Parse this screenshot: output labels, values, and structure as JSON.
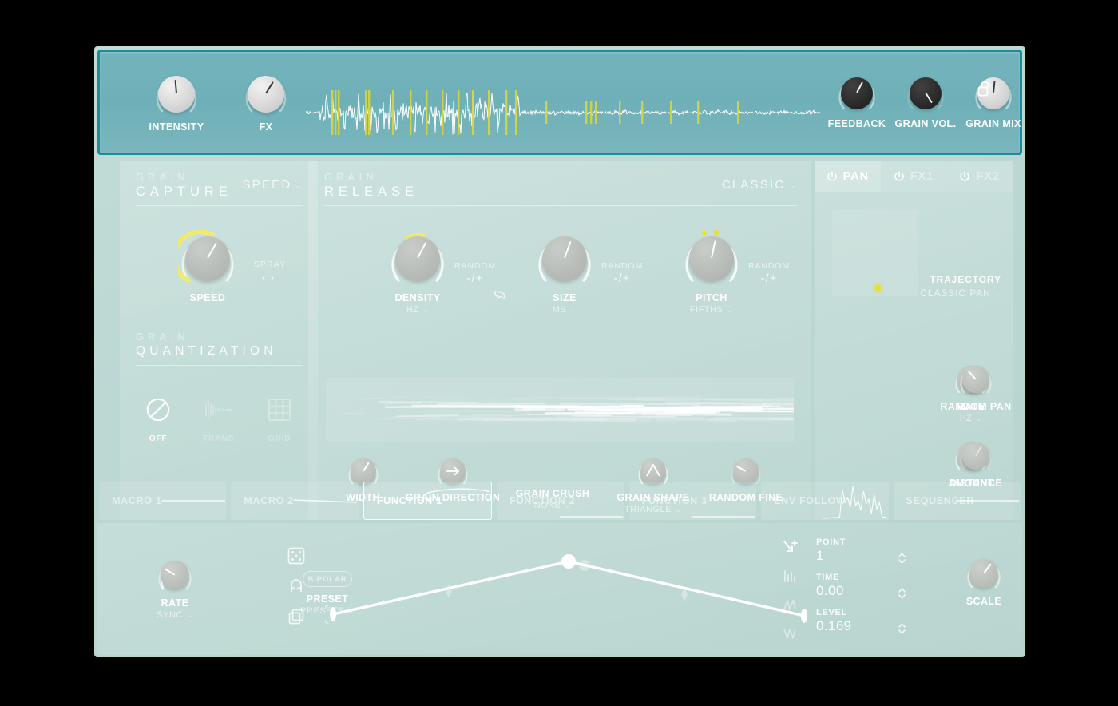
{
  "header": {
    "knobs": [
      {
        "label": "INTENSITY",
        "style": "light",
        "angle": -5,
        "arc": 0.52
      },
      {
        "label": "FX",
        "style": "light",
        "angle": 32,
        "arc": 0.62
      },
      {
        "label": "FEEDBACK",
        "style": "dark",
        "angle": 28,
        "arc": 0.6
      },
      {
        "label": "GRAIN VOL.",
        "style": "dark",
        "angle": 148,
        "arc": 0.97
      },
      {
        "label": "GRAIN MIX",
        "style": "light",
        "angle": 6,
        "arc": 0.56
      }
    ],
    "lock_icon": "unlocked-padlock-icon",
    "waveform_name": "sample-waveform-display",
    "waveform_colors": {
      "wave": "#ffffff",
      "grain_marker": "#d8d63a"
    }
  },
  "grain_capture": {
    "section_top": "GRAIN",
    "section_main": "CAPTURE",
    "mode_select": "SPEED",
    "knob": {
      "label": "SPEED",
      "angle": 30,
      "arc": 0.62,
      "highlight_color": "#f0ea6e"
    },
    "spray": {
      "label": "SPRAY",
      "left_arrow": "‹",
      "right_arrow": "›"
    }
  },
  "grain_quantization": {
    "section_top": "GRAIN",
    "section_main": "QUANTIZATION",
    "options": [
      {
        "label": "OFF",
        "icon": "no-entry-icon",
        "selected": true
      },
      {
        "label": "TRANS.",
        "icon": "transient-waveform-icon",
        "selected": false
      },
      {
        "label": "GRID",
        "icon": "grid-icon",
        "selected": false
      }
    ]
  },
  "grain_release": {
    "section_top": "GRAIN",
    "section_main": "RELEASE",
    "mode_select": "CLASSIC",
    "main_knobs": [
      {
        "label": "DENSITY",
        "unit": "HZ",
        "random_label": "RANDOM",
        "random_value": "-/+",
        "angle": 28,
        "arc": 0.63,
        "highlight": true,
        "dots": 0
      },
      {
        "label": "SIZE",
        "unit": "MS",
        "random_label": "RANDOM",
        "random_value": "-/+",
        "angle": 20,
        "arc": 0.6,
        "highlight": false,
        "dots": 0
      },
      {
        "label": "PITCH",
        "unit": "FIFTHS",
        "random_label": "RANDOM",
        "random_value": "-/+",
        "angle": 12,
        "arc": 0.55,
        "highlight": false,
        "dots": 2
      }
    ],
    "link_icon": "chain-link-icon",
    "viz_name": "grain-stream-visualizer",
    "small_controls": [
      {
        "label": "WIDTH",
        "sub": "",
        "type": "knob",
        "angle": 32,
        "arc": 0.62
      },
      {
        "label": "GRAIN DIRECTION",
        "sub": "",
        "type": "icon",
        "icon": "arrow-right-icon",
        "arc": 0.7
      },
      {
        "label": "GRAIN CRUSH",
        "sub": "NONE",
        "type": "none"
      },
      {
        "label": "GRAIN SHAPE",
        "sub": "TRIANGLE",
        "type": "icon",
        "icon": "triangle-shape-icon",
        "arc": 0.8
      },
      {
        "label": "RANDOM FINE",
        "sub": "",
        "type": "knob",
        "angle": -62,
        "arc": 0.2
      }
    ]
  },
  "right_panel": {
    "tabs": [
      {
        "label": "PAN",
        "active": true,
        "power_icon": "power-icon"
      },
      {
        "label": "FX1",
        "active": false,
        "power_icon": "power-icon"
      },
      {
        "label": "FX2",
        "active": false,
        "power_icon": "power-icon"
      }
    ],
    "xypad": {
      "name": "pan-xy-pad",
      "dot_x": 0.49,
      "dot_y": 0.86,
      "dot_color": "#e8e03a"
    },
    "trajectory": {
      "label": "TRAJECTORY",
      "value": "CLASSIC PAN"
    },
    "knobs": [
      {
        "label": "RATE",
        "sub": "HZ",
        "angle": -24,
        "arc": 0.4
      },
      {
        "label": "RANDOM PAN",
        "sub": "",
        "angle": -42,
        "arc": 0.3
      },
      {
        "label": "AMOUNT",
        "sub": "",
        "angle": 24,
        "arc": 0.58
      },
      {
        "label": "DISTANCE",
        "sub": "",
        "angle": 30,
        "arc": 0.0
      }
    ]
  },
  "mod_bar": {
    "tabs": [
      {
        "label": "MACRO 1",
        "active": false,
        "viz": "flat-line"
      },
      {
        "label": "MACRO 2",
        "active": false,
        "viz": "flat-line"
      },
      {
        "label": "FUNCTION 1",
        "active": true,
        "viz": "curve"
      },
      {
        "label": "FUNCTION 2",
        "active": false,
        "viz": "flat-line"
      },
      {
        "label": "FUNCTION 3",
        "active": false,
        "viz": "flat-line"
      },
      {
        "label": "ENV FOLLOW",
        "active": false,
        "viz": "envelope"
      },
      {
        "label": "SEQUENCER",
        "active": false,
        "viz": "flat-line"
      }
    ]
  },
  "function_editor": {
    "rate": {
      "label": "RATE",
      "sub": "SYNC",
      "angle": -58,
      "arc": 0.22
    },
    "bipolar_label": "BIPOLAR",
    "preset": {
      "label": "PRESET",
      "sub": "PRESETS"
    },
    "side_icons": [
      {
        "name": "dice-icon"
      },
      {
        "name": "magnet-icon"
      },
      {
        "name": "copy-icon"
      }
    ],
    "value_icons": [
      {
        "name": "add-point-icon",
        "active": true
      },
      {
        "name": "bar-steps-icon",
        "active": false
      },
      {
        "name": "ramp-up-icon",
        "active": false
      },
      {
        "name": "ramp-down-icon",
        "active": false
      }
    ],
    "values": [
      {
        "label": "POINT",
        "value": "1"
      },
      {
        "label": "TIME",
        "value": "0.00"
      },
      {
        "label": "LEVEL",
        "value": "0.169"
      }
    ],
    "scale": {
      "label": "SCALE",
      "angle": 36,
      "arc": 0.64
    },
    "curve_name": "function-curve-editor",
    "curve_points": [
      {
        "x": 0.0,
        "y": 0.3
      },
      {
        "x": 0.5,
        "y": 0.92
      },
      {
        "x": 1.0,
        "y": 0.28
      }
    ]
  },
  "theme": {
    "bg": "#b8d4d0",
    "header_fill": "#74b3bb",
    "header_border": "#1d8d9e",
    "accent_yellow": "#e8e03a",
    "text_white": "#ffffff"
  }
}
